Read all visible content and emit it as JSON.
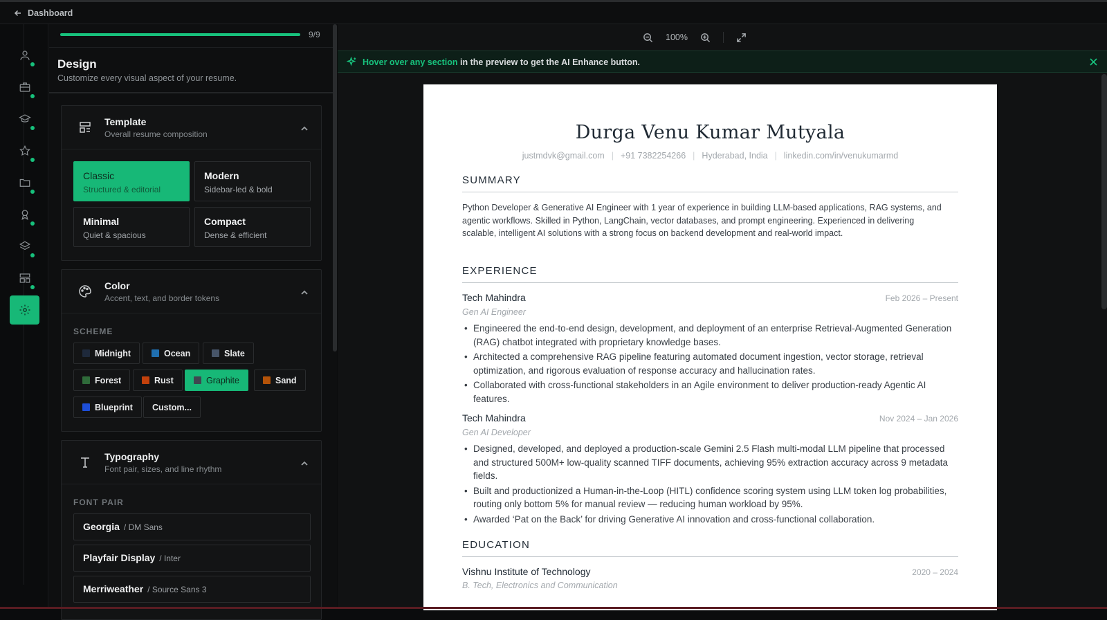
{
  "topbar": {
    "back_label": "Dashboard"
  },
  "rail": {
    "items": [
      {
        "icon": "user-icon",
        "done": true
      },
      {
        "icon": "briefcase-icon",
        "done": true
      },
      {
        "icon": "graduation-cap-icon",
        "done": true
      },
      {
        "icon": "star-icon",
        "done": true
      },
      {
        "icon": "folder-icon",
        "done": true
      },
      {
        "icon": "award-icon",
        "done": true
      },
      {
        "icon": "layers-icon",
        "done": true
      },
      {
        "icon": "layout-icon",
        "done": true
      },
      {
        "icon": "gear-icon",
        "active": true
      }
    ]
  },
  "progress": {
    "label": "9/9",
    "fraction": 1.0
  },
  "design": {
    "title": "Design",
    "subtitle": "Customize every visual aspect of your resume."
  },
  "template_card": {
    "title": "Template",
    "subtitle": "Overall resume composition",
    "options": [
      {
        "name": "Classic",
        "desc": "Structured & editorial",
        "selected": true
      },
      {
        "name": "Modern",
        "desc": "Sidebar-led & bold"
      },
      {
        "name": "Minimal",
        "desc": "Quiet & spacious"
      },
      {
        "name": "Compact",
        "desc": "Dense & efficient"
      }
    ]
  },
  "color_card": {
    "title": "Color",
    "subtitle": "Accent, text, and border tokens",
    "scheme_label": "SCHEME",
    "schemes": [
      {
        "name": "Midnight",
        "color": "#1e293b"
      },
      {
        "name": "Ocean",
        "color": "#1f6fb0"
      },
      {
        "name": "Slate",
        "color": "#475569"
      },
      {
        "name": "Forest",
        "color": "#2f6b3a"
      },
      {
        "name": "Rust",
        "color": "#c2410c"
      },
      {
        "name": "Graphite",
        "color": "#3f4650",
        "selected": true
      },
      {
        "name": "Sand",
        "color": "#b45309"
      },
      {
        "name": "Blueprint",
        "color": "#1d4ed8"
      },
      {
        "name": "Custom..."
      }
    ]
  },
  "typography_card": {
    "title": "Typography",
    "subtitle": "Font pair, sizes, and line rhythm",
    "font_pair_label": "FONT PAIR",
    "pairs": [
      {
        "heading": "Georgia",
        "body": "/ DM Sans"
      },
      {
        "heading": "Playfair Display",
        "body": "/ Inter"
      },
      {
        "heading": "Merriweather",
        "body": "/ Source Sans 3"
      }
    ]
  },
  "toolbar": {
    "zoom": "100%"
  },
  "banner": {
    "highlight": "Hover over any section",
    "rest": " in the preview to get the AI Enhance button."
  },
  "resume": {
    "name": "Durga Venu Kumar Mutyala",
    "contact": [
      "justmdvk@gmail.com",
      "+91 7382254266",
      "Hyderabad, India",
      "linkedin.com/in/venukumarmd"
    ],
    "summary_heading": "SUMMARY",
    "summary": "Python Developer & Generative AI Engineer with 1 year of experience in building LLM-based applications, RAG systems, and agentic workflows. Skilled in Python, LangChain, vector databases, and prompt engineering. Experienced in delivering scalable, intelligent AI solutions with a strong focus on backend development and real-world impact.",
    "experience_heading": "EXPERIENCE",
    "jobs": [
      {
        "company": "Tech Mahindra",
        "dates": "Feb 2026 – Present",
        "role": "Gen AI Engineer",
        "bullets": [
          "Engineered the end-to-end design, development, and deployment of an enterprise Retrieval-Augmented Generation (RAG) chatbot integrated with proprietary knowledge bases.",
          "Architected a comprehensive RAG pipeline featuring automated document ingestion, vector storage, retrieval optimization, and rigorous evaluation of response accuracy and hallucination rates.",
          "Collaborated with cross-functional stakeholders in an Agile environment to deliver production-ready Agentic AI features."
        ]
      },
      {
        "company": "Tech Mahindra",
        "dates": "Nov 2024 – Jan 2026",
        "role": "Gen AI Developer",
        "bullets": [
          "Designed, developed, and deployed a production-scale Gemini 2.5 Flash multi-modal LLM pipeline that processed and structured 500M+ low-quality scanned TIFF documents, achieving 95% extraction accuracy across 9 metadata fields.",
          "Built and productionized a Human-in-the-Loop (HITL) confidence scoring system using LLM token log probabilities, routing only bottom 5% for manual review — reducing human workload by 95%.",
          "Awarded ‘Pat on the Back’ for driving Generative AI innovation and cross-functional collaboration."
        ]
      }
    ],
    "education_heading": "EDUCATION",
    "education": {
      "school": "Vishnu Institute of Technology",
      "dates": "2020 – 2024",
      "degree": "B. Tech, Electronics and Communication"
    }
  }
}
